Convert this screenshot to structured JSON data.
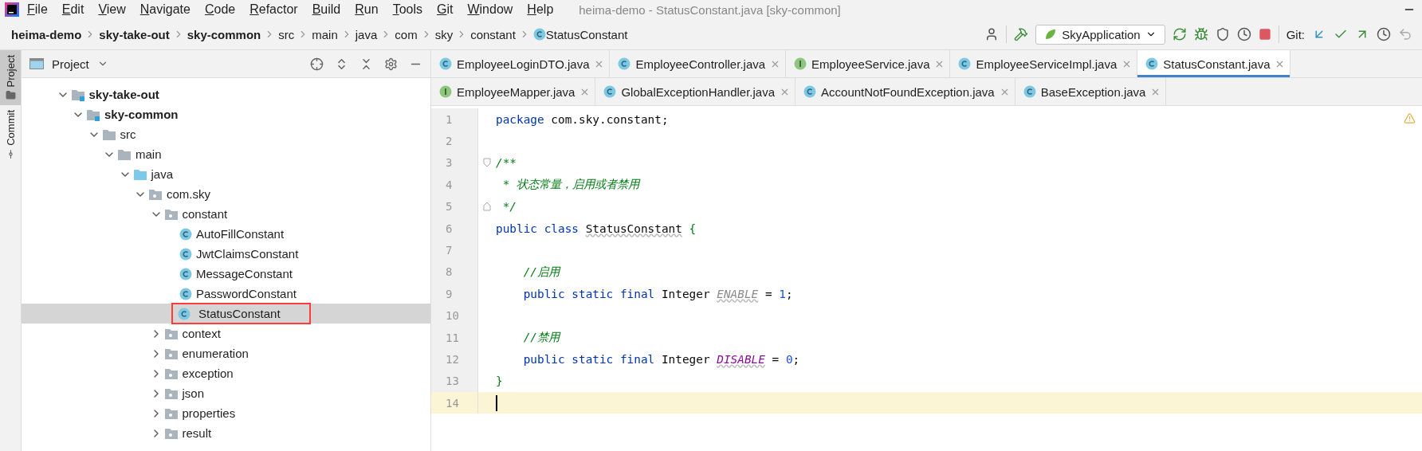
{
  "window": {
    "title": "heima-demo - StatusConstant.java [sky-common]"
  },
  "menu": [
    "File",
    "Edit",
    "View",
    "Navigate",
    "Code",
    "Refactor",
    "Build",
    "Run",
    "Tools",
    "Git",
    "Window",
    "Help"
  ],
  "breadcrumbs": [
    {
      "label": "heima-demo",
      "kind": "module"
    },
    {
      "label": "sky-take-out",
      "kind": "module"
    },
    {
      "label": "sky-common",
      "kind": "module"
    },
    {
      "label": "src",
      "kind": "folder"
    },
    {
      "label": "main",
      "kind": "folder"
    },
    {
      "label": "java",
      "kind": "folder"
    },
    {
      "label": "com",
      "kind": "folder"
    },
    {
      "label": "sky",
      "kind": "folder"
    },
    {
      "label": "constant",
      "kind": "folder"
    },
    {
      "label": "StatusConstant",
      "kind": "class"
    }
  ],
  "toolbar": {
    "run_config": "SkyApplication",
    "git_label": "Git:"
  },
  "left_strip": [
    {
      "label": "Project",
      "selected": true
    },
    {
      "label": "Commit",
      "selected": false
    }
  ],
  "project_panel": {
    "title": "Project",
    "tree": [
      {
        "label": "sky-take-out",
        "kind": "module",
        "expanded": true,
        "selected": false,
        "annotated": false,
        "children": [
          {
            "label": "sky-common",
            "kind": "module",
            "expanded": true,
            "selected": false,
            "annotated": false,
            "children": [
              {
                "label": "src",
                "kind": "folder",
                "expanded": true,
                "selected": false,
                "annotated": false,
                "children": [
                  {
                    "label": "main",
                    "kind": "folder",
                    "expanded": true,
                    "selected": false,
                    "annotated": false,
                    "children": [
                      {
                        "label": "java",
                        "kind": "source",
                        "expanded": true,
                        "selected": false,
                        "annotated": false,
                        "children": [
                          {
                            "label": "com.sky",
                            "kind": "package",
                            "expanded": true,
                            "selected": false,
                            "annotated": false,
                            "children": [
                              {
                                "label": "constant",
                                "kind": "package",
                                "expanded": true,
                                "selected": false,
                                "annotated": false,
                                "children": [
                                  {
                                    "label": "AutoFillConstant",
                                    "kind": "class",
                                    "selected": false,
                                    "annotated": false
                                  },
                                  {
                                    "label": "JwtClaimsConstant",
                                    "kind": "class",
                                    "selected": false,
                                    "annotated": false
                                  },
                                  {
                                    "label": "MessageConstant",
                                    "kind": "class",
                                    "selected": false,
                                    "annotated": false
                                  },
                                  {
                                    "label": "PasswordConstant",
                                    "kind": "class",
                                    "selected": false,
                                    "annotated": false
                                  },
                                  {
                                    "label": "StatusConstant",
                                    "kind": "class",
                                    "selected": true,
                                    "annotated": true
                                  }
                                ]
                              },
                              {
                                "label": "context",
                                "kind": "package",
                                "expanded": false,
                                "selected": false,
                                "annotated": false
                              },
                              {
                                "label": "enumeration",
                                "kind": "package",
                                "expanded": false,
                                "selected": false,
                                "annotated": false
                              },
                              {
                                "label": "exception",
                                "kind": "package",
                                "expanded": false,
                                "selected": false,
                                "annotated": false
                              },
                              {
                                "label": "json",
                                "kind": "package",
                                "expanded": false,
                                "selected": false,
                                "annotated": false
                              },
                              {
                                "label": "properties",
                                "kind": "package",
                                "expanded": false,
                                "selected": false,
                                "annotated": false
                              },
                              {
                                "label": "result",
                                "kind": "package",
                                "expanded": false,
                                "selected": false,
                                "annotated": false
                              }
                            ]
                          }
                        ]
                      }
                    ]
                  }
                ]
              }
            ]
          }
        ]
      }
    ]
  },
  "editor": {
    "tab_rows": [
      [
        {
          "label": "EmployeeLoginDTO.java",
          "kind": "class",
          "selected": false
        },
        {
          "label": "EmployeeController.java",
          "kind": "class",
          "selected": false
        },
        {
          "label": "EmployeeService.java",
          "kind": "interface",
          "selected": false
        },
        {
          "label": "EmployeeServiceImpl.java",
          "kind": "class",
          "selected": false
        },
        {
          "label": "StatusConstant.java",
          "kind": "class",
          "selected": true
        }
      ],
      [
        {
          "label": "EmployeeMapper.java",
          "kind": "interface",
          "selected": false
        },
        {
          "label": "GlobalExceptionHandler.java",
          "kind": "class",
          "selected": false
        },
        {
          "label": "AccountNotFoundException.java",
          "kind": "class",
          "selected": false
        },
        {
          "label": "BaseException.java",
          "kind": "class",
          "selected": false
        }
      ]
    ],
    "lines": [
      {
        "number": "1",
        "current": false,
        "tokens": [
          {
            "text": "package",
            "kind": "keyword"
          },
          {
            "text": " com.sky.constant;",
            "kind": "text"
          }
        ]
      },
      {
        "number": "2",
        "current": false
      },
      {
        "number": "3",
        "current": false,
        "fold_start": true,
        "tokens": [
          {
            "text": "/**",
            "kind": "comment"
          }
        ]
      },
      {
        "number": "4",
        "current": false,
        "tokens": [
          {
            "text": " * 状态常量，启用或者禁用",
            "kind": "comment"
          }
        ]
      },
      {
        "number": "5",
        "current": false,
        "fold_end": true,
        "tokens": [
          {
            "text": " */",
            "kind": "comment"
          }
        ]
      },
      {
        "number": "6",
        "current": false,
        "tokens": [
          {
            "text": "public class ",
            "kind": "keyword"
          },
          {
            "text": "StatusConstant",
            "kind": "class-decl"
          },
          {
            "text": " {",
            "kind": "brace"
          }
        ]
      },
      {
        "number": "7",
        "current": false
      },
      {
        "number": "8",
        "current": false,
        "tokens": [
          {
            "text": "    //启用",
            "kind": "comment"
          }
        ]
      },
      {
        "number": "9",
        "current": false,
        "tokens": [
          {
            "text": "    public static final",
            "kind": "keyword"
          },
          {
            "text": " Integer ",
            "kind": "text"
          },
          {
            "text": "ENABLE",
            "kind": "unused-constant"
          },
          {
            "text": " = ",
            "kind": "text"
          },
          {
            "text": "1",
            "kind": "number"
          },
          {
            "text": ";",
            "kind": "text"
          }
        ]
      },
      {
        "number": "10",
        "current": false
      },
      {
        "number": "11",
        "current": false,
        "tokens": [
          {
            "text": "    //禁用",
            "kind": "comment"
          }
        ]
      },
      {
        "number": "12",
        "current": false,
        "tokens": [
          {
            "text": "    public static final",
            "kind": "keyword"
          },
          {
            "text": " Integer ",
            "kind": "text"
          },
          {
            "text": "DISABLE",
            "kind": "constant"
          },
          {
            "text": " = ",
            "kind": "text"
          },
          {
            "text": "0",
            "kind": "number"
          },
          {
            "text": ";",
            "kind": "text"
          }
        ]
      },
      {
        "number": "13",
        "current": false,
        "tokens": [
          {
            "text": "}",
            "kind": "brace"
          }
        ]
      },
      {
        "number": "14",
        "current": true
      }
    ]
  }
}
